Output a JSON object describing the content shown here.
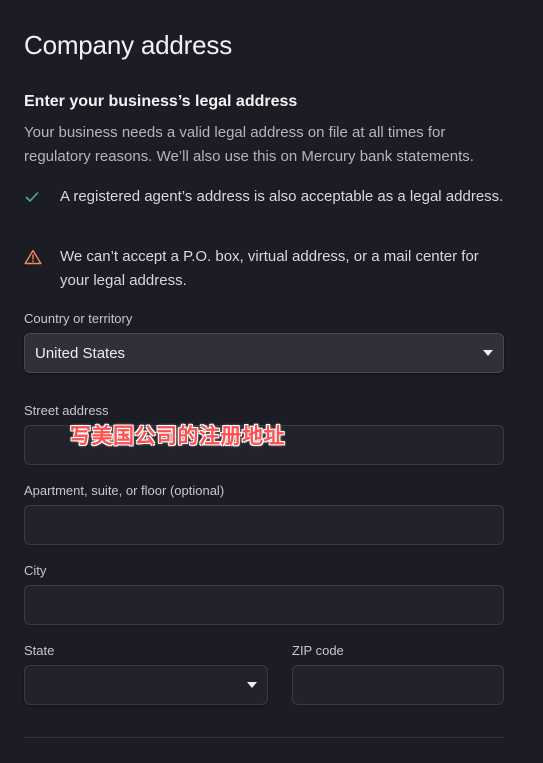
{
  "header": {
    "title": "Company address"
  },
  "section": {
    "heading": "Enter your business’s legal address",
    "description": "Your business needs a valid legal address on file at all times for regulatory reasons. We’ll also use this on Mercury bank statements."
  },
  "notes": [
    {
      "icon": "check-icon",
      "text": "A registered agent’s address is also acceptable as a legal address.",
      "color": "#3fb97a"
    },
    {
      "icon": "warning-icon",
      "text": "We can’t accept a P.O. box, virtual address, or a mail center for your legal address.",
      "color": "#f08a5d"
    }
  ],
  "form": {
    "country": {
      "label": "Country or territory",
      "value": "United States"
    },
    "street": {
      "label": "Street address",
      "value": ""
    },
    "apartment": {
      "label": "Apartment, suite, or floor (optional)",
      "value": ""
    },
    "city": {
      "label": "City",
      "value": ""
    },
    "state": {
      "label": "State",
      "value": ""
    },
    "zip": {
      "label": "ZIP code",
      "value": ""
    }
  },
  "overlay": {
    "text": "写美国公司的注册地址",
    "color": "#ff4f4f"
  }
}
